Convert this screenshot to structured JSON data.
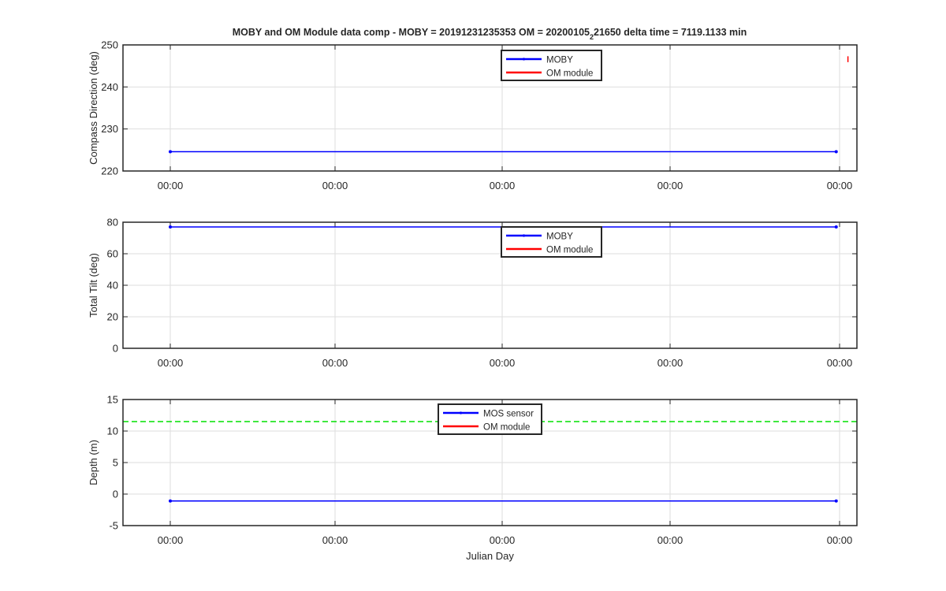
{
  "figure": {
    "title_parts": [
      "MOBY and OM Module data comp - MOBY = 20191231235353 OM = 20200105",
      "2",
      "21650 delta time = 7119.1133 min"
    ]
  },
  "chart_data": [
    {
      "type": "line",
      "title": "MOBY and OM Module data comp - MOBY = 20191231235353 OM = 20200105_21650 delta time = 7119.1133 min",
      "xlabel": "",
      "ylabel": "Compass Direction (deg)",
      "ylim": [
        220,
        250
      ],
      "yticks": [
        220,
        230,
        240,
        250
      ],
      "xticks": [
        "00:00",
        "00:00",
        "00:00",
        "00:00",
        "00:00"
      ],
      "grid": true,
      "legend": "top-center",
      "series": [
        {
          "name": "MOBY",
          "color": "#0000ff",
          "x": [
            0.0,
            3.98
          ],
          "y": [
            224.6,
            224.6
          ]
        },
        {
          "name": "OM module",
          "color": "#ff0000",
          "x": [
            4.05,
            4.05
          ],
          "y": [
            245.9,
            247.3
          ]
        }
      ],
      "hlines": []
    },
    {
      "type": "line",
      "xlabel": "",
      "ylabel": "Total Tilt (deg)",
      "ylim": [
        0,
        80
      ],
      "yticks": [
        0,
        20,
        40,
        60,
        80
      ],
      "xticks": [
        "00:00",
        "00:00",
        "00:00",
        "00:00",
        "00:00"
      ],
      "grid": true,
      "legend": "top-center",
      "series": [
        {
          "name": "MOBY",
          "color": "#0000ff",
          "x": [
            0.0,
            3.98
          ],
          "y": [
            77,
            77
          ]
        },
        {
          "name": "OM module",
          "color": "#ff0000",
          "x": [],
          "y": []
        }
      ],
      "hlines": []
    },
    {
      "type": "line",
      "xlabel": "Julian Day",
      "ylabel": "Depth (m)",
      "ylim": [
        -5,
        15
      ],
      "yticks": [
        -5,
        0,
        5,
        10,
        15
      ],
      "xticks": [
        "00:00",
        "00:00",
        "00:00",
        "00:00",
        "00:00"
      ],
      "grid": true,
      "legend": "top-center",
      "series": [
        {
          "name": "MOS sensor",
          "color": "#0000ff",
          "x": [
            0.0,
            3.98
          ],
          "y": [
            -1.1,
            -1.1
          ]
        },
        {
          "name": "OM module",
          "color": "#ff0000",
          "x": [],
          "y": []
        }
      ],
      "hlines": [
        {
          "y": 11.5,
          "color": "#00e000",
          "style": "dashed"
        }
      ]
    }
  ]
}
